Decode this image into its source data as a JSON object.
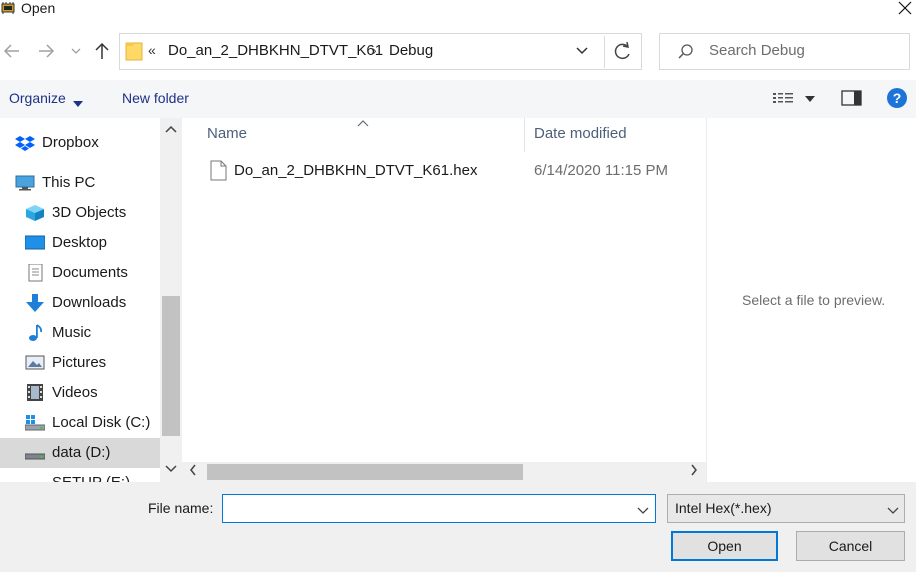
{
  "window": {
    "title": "Open"
  },
  "address": {
    "overflow": "«",
    "crumbs": [
      "Do_an_2_DHBKHN_DTVT_K61",
      "Debug"
    ],
    "separator": "›"
  },
  "search": {
    "placeholder": "Search Debug"
  },
  "toolbar": {
    "organize_label": "Organize",
    "new_folder_label": "New folder"
  },
  "nav": {
    "items": [
      {
        "label": "Dropbox",
        "icon": "dropbox-icon"
      },
      {
        "label": "This PC",
        "icon": "computer-icon"
      },
      {
        "label": "3D Objects",
        "icon": "cube-icon"
      },
      {
        "label": "Desktop",
        "icon": "desktop-icon"
      },
      {
        "label": "Documents",
        "icon": "document-icon"
      },
      {
        "label": "Downloads",
        "icon": "download-arrow-icon"
      },
      {
        "label": "Music",
        "icon": "music-note-icon"
      },
      {
        "label": "Pictures",
        "icon": "picture-icon"
      },
      {
        "label": "Videos",
        "icon": "film-icon"
      },
      {
        "label": "Local Disk (C:)",
        "icon": "windows-drive-icon"
      },
      {
        "label": "data (D:)",
        "icon": "drive-icon",
        "selected": true
      },
      {
        "label": "SETUP (E:)",
        "icon": "drive-icon"
      }
    ]
  },
  "files": {
    "columns": {
      "name": "Name",
      "date": "Date modified"
    },
    "rows": [
      {
        "name": "Do_an_2_DHBKHN_DTVT_K61.hex",
        "date": "6/14/2020 11:15 PM"
      }
    ]
  },
  "preview": {
    "message": "Select a file to preview."
  },
  "bottom": {
    "filename_label": "File name:",
    "filename_value": "",
    "filetype_value": "Intel Hex(*.hex)",
    "open_label": "Open",
    "cancel_label": "Cancel"
  },
  "colors": {
    "accent": "#0078d7",
    "link": "#1e3287",
    "selected": "#d9d9d9",
    "help": "#1e73d8"
  }
}
